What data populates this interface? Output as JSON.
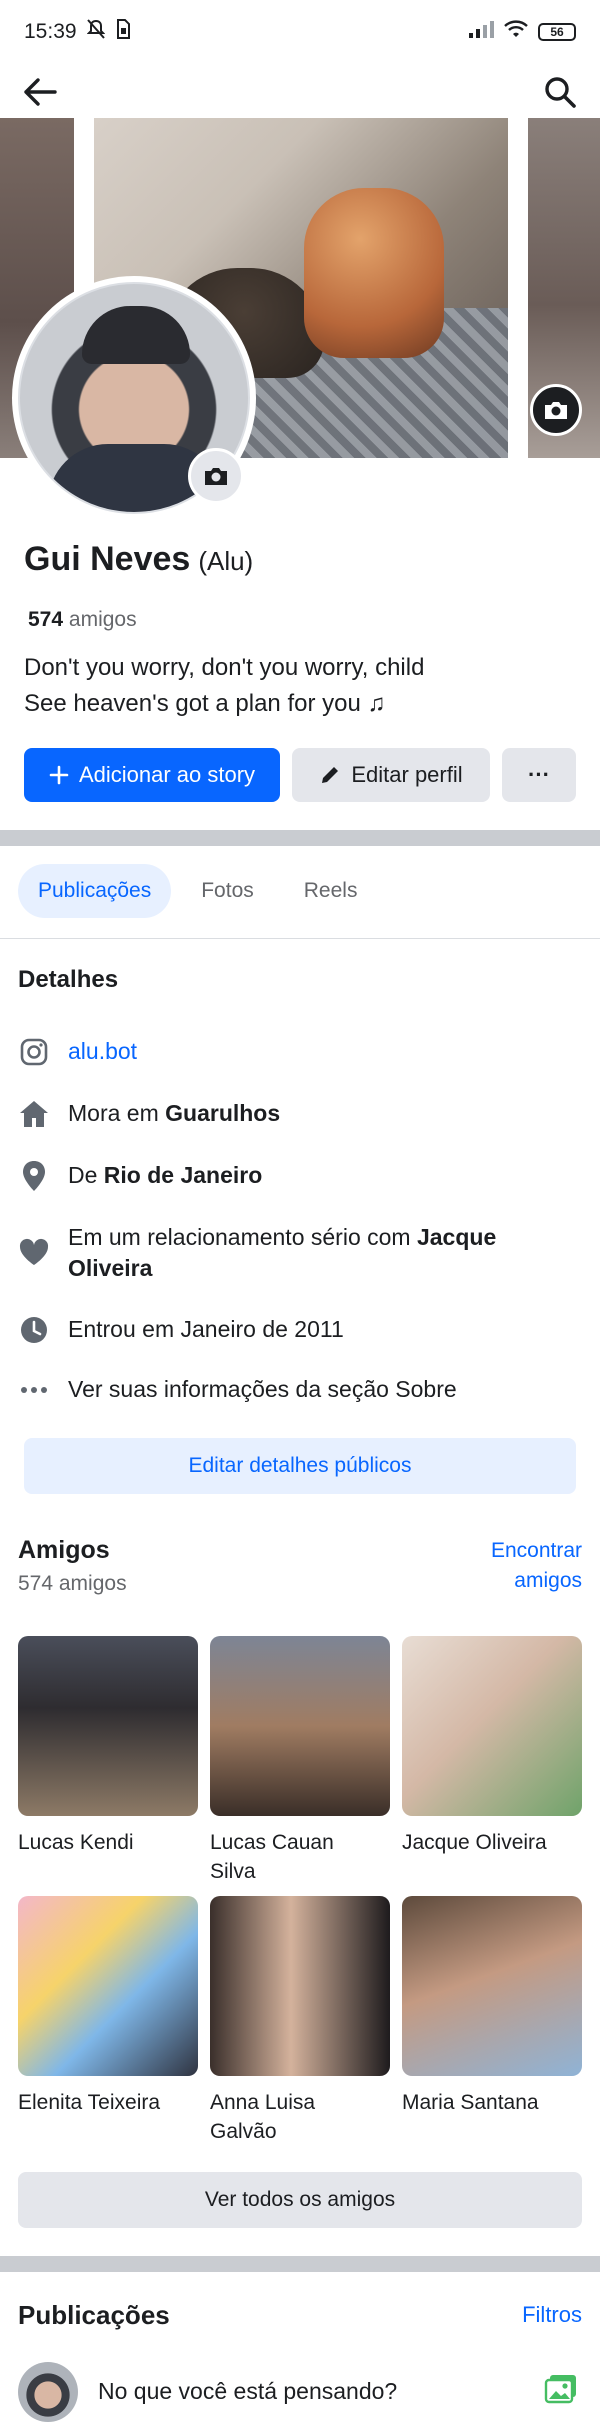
{
  "status": {
    "time": "15:39",
    "battery": "56"
  },
  "colors": {
    "accent": "#0866ff",
    "accent_soft": "#e7f0ff",
    "gray_button": "#e4e6eb",
    "secondary_text": "#65676b"
  },
  "profile": {
    "name": "Gui Neves",
    "nickname": "(Alu)",
    "friends_number": "574",
    "friends_word": "amigos",
    "bio_line1": "Don't you worry, don't you worry, child",
    "bio_line2": "See heaven's got a plan for you ♫"
  },
  "actions": {
    "add_story": "Adicionar ao story",
    "edit_profile": "Editar perfil",
    "more": "···"
  },
  "tabs": [
    {
      "label": "Publicações",
      "active": true
    },
    {
      "label": "Fotos"
    },
    {
      "label": "Reels"
    }
  ],
  "details": {
    "title": "Detalhes",
    "instagram": "alu.bot",
    "lives_prefix": "Mora em",
    "lives_city": "Guarulhos",
    "from_prefix": "De",
    "from_city": "Rio de Janeiro",
    "relationship_prefix": "Em um relacionamento sério com",
    "relationship_name": "Jacque Oliveira",
    "joined": "Entrou em Janeiro de 2011",
    "about": "Ver suas informações da seção Sobre",
    "edit_public": "Editar detalhes públicos"
  },
  "friends": {
    "title": "Amigos",
    "count_text": "574 amigos",
    "find_line1": "Encontrar",
    "find_line2": "amigos",
    "items": [
      {
        "name_line1": "Lucas Kendi",
        "name_line2": ""
      },
      {
        "name_line1": "Lucas Cauan",
        "name_line2": "Silva"
      },
      {
        "name_line1": "Jacque Oliveira",
        "name_line2": ""
      },
      {
        "name_line1": "Elenita Teixeira",
        "name_line2": ""
      },
      {
        "name_line1": "Anna Luisa",
        "name_line2": "Galvão"
      },
      {
        "name_line1": "Maria Santana",
        "name_line2": ""
      }
    ],
    "see_all": "Ver todos os amigos"
  },
  "posts": {
    "title": "Publicações",
    "filters": "Filtros",
    "composer_placeholder": "No que você está pensando?"
  },
  "icons": {
    "status": [
      "muted-bell-icon",
      "sim-icon",
      "signal-icon",
      "wifi-icon",
      "battery-icon"
    ],
    "top": [
      "back-arrow-icon",
      "search-icon"
    ],
    "details": [
      "instagram-icon",
      "home-icon",
      "location-pin-icon",
      "heart-icon",
      "clock-icon",
      "more-dots-icon"
    ]
  }
}
